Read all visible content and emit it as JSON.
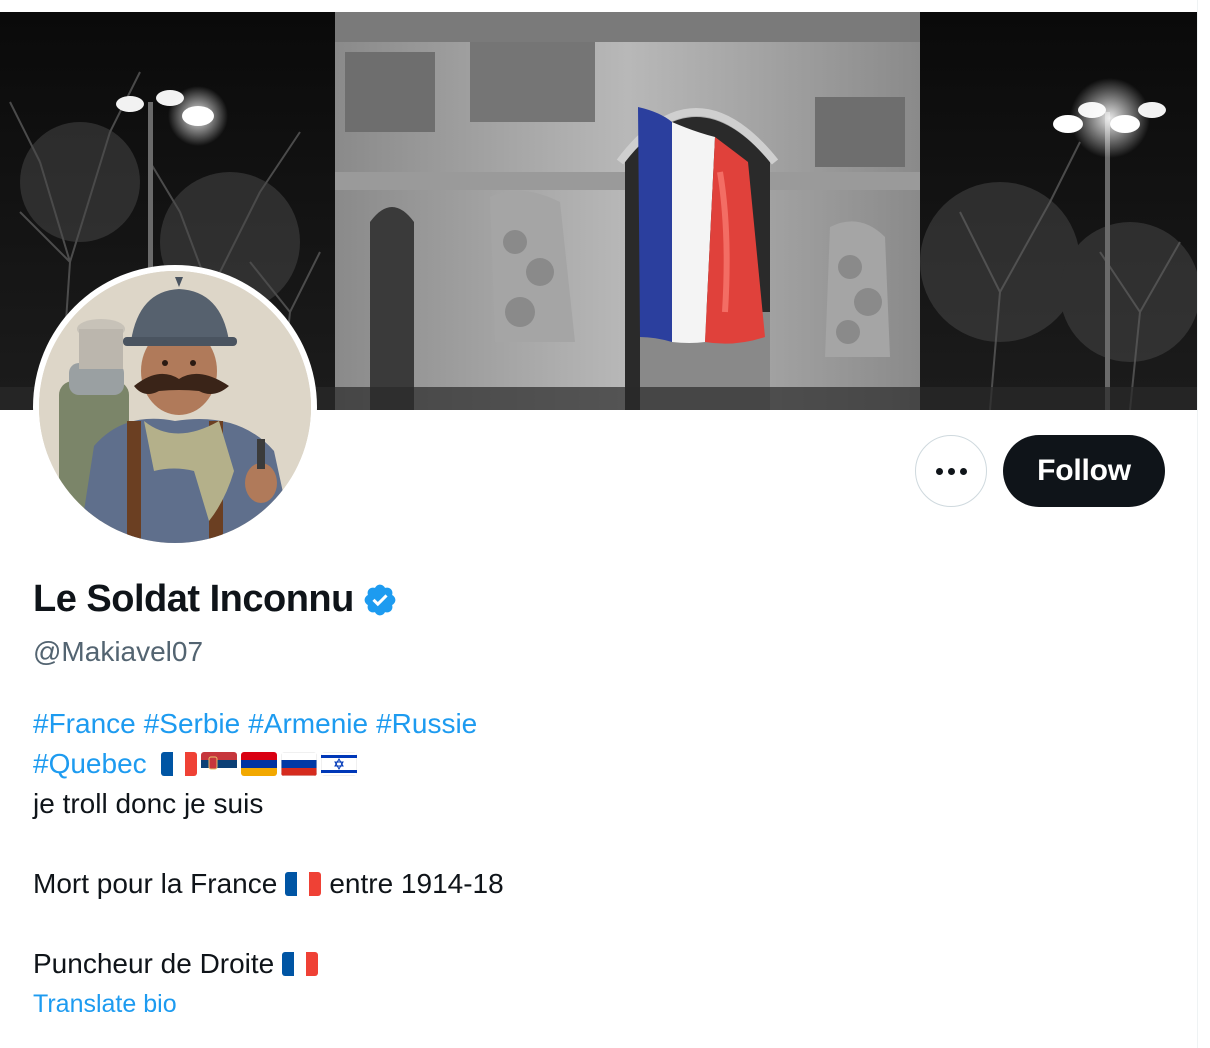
{
  "profile": {
    "display_name": "Le Soldat Inconnu",
    "handle": "@Makiavel07",
    "verified": true,
    "verified_color": "#1d9bf0"
  },
  "actions": {
    "more_icon": "more-horizontal-icon",
    "follow_label": "Follow"
  },
  "bio": {
    "hashtags_line1": [
      "#France",
      "#Serbie",
      "#Armenie",
      "#Russie"
    ],
    "hashtags_line2": [
      "#Quebec"
    ],
    "flags_line2": [
      "france-flag-icon",
      "serbia-flag-icon",
      "armenia-flag-icon",
      "russia-flag-icon",
      "israel-flag-icon"
    ],
    "line3": "je troll donc je suis",
    "line5_before": "Mort pour la France",
    "line5_flag": "france-flag-icon",
    "line5_after": "entre 1914-18",
    "line7": "Puncheur de Droite",
    "line7_flag": "france-flag-icon"
  },
  "translate_label": "Translate bio",
  "colors": {
    "link": "#1d9bf0",
    "text": "#0f1419",
    "secondary_text": "#536471",
    "button_dark": "#0f1419"
  }
}
